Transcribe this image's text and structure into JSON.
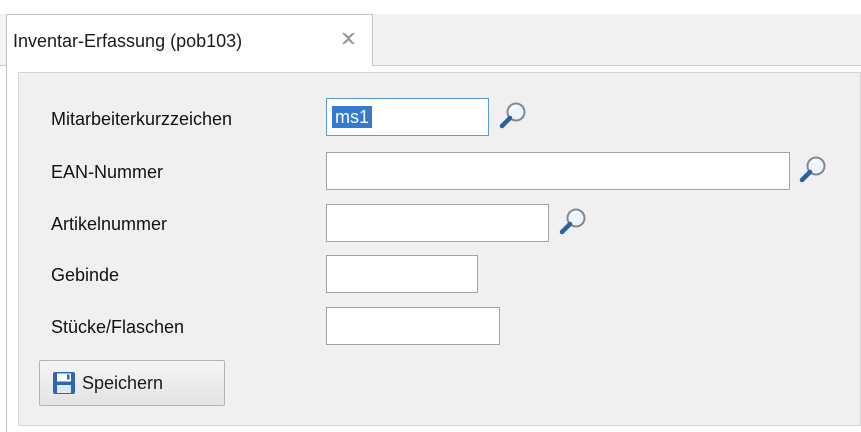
{
  "tab": {
    "title": "Inventar-Erfassung (pob103)",
    "close_glyph": "close-icon"
  },
  "form": {
    "fields": [
      {
        "label": "Mitarbeiterkurzzeichen",
        "value": "ms1",
        "has_search": true,
        "focused": true
      },
      {
        "label": "EAN-Nummer",
        "value": "",
        "has_search": true
      },
      {
        "label": "Artikelnummer",
        "value": "",
        "has_search": true
      },
      {
        "label": "Gebinde",
        "value": "",
        "has_search": false
      },
      {
        "label": "Stücke/Flaschen",
        "value": "",
        "has_search": false
      }
    ],
    "save_label": "Speichern",
    "save_icon": "floppy-disk-icon",
    "search_icon": "magnifier-icon"
  },
  "colors": {
    "selection": "#3579d1",
    "focus_border": "#5a9ad6",
    "panel_bg": "#f0f0f0"
  }
}
